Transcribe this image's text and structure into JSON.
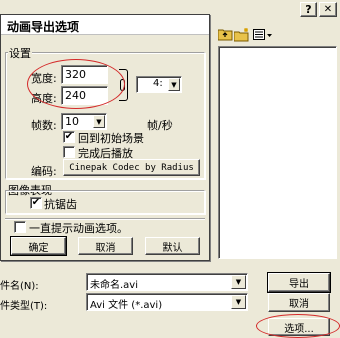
{
  "parent_window": {
    "top_buttons": {
      "help": "?",
      "close": "✕"
    },
    "toolbar_icons": [
      "up-folder-icon",
      "new-folder-icon",
      "view-menu-icon"
    ],
    "filename_label": "件名(N):",
    "filename_value": "未命名.avi",
    "filetype_label": "件类型(T):",
    "filetype_value": "Avi 文件 (*.avi)",
    "export_button": "导出",
    "cancel_button": "取消",
    "options_button": "选项..."
  },
  "dialog": {
    "title": "动画导出选项",
    "size_group_label": "设置",
    "width_label": "宽度:",
    "width_value": "320",
    "height_label": "高度:",
    "height_value": "240",
    "aspect_value": "4:",
    "fps_label": "帧数:",
    "fps_value": "10",
    "fps_unit": "帧/秒",
    "rewind_label": "回到初始场景",
    "rewind_checked": true,
    "play_after_label": "完成后播放",
    "play_after_checked": false,
    "codec_label": "编码:",
    "codec_button": "Cinepak Codec by Radius",
    "image_group_label": "图像表现",
    "antialias_label": "抗锯齿",
    "antialias_checked": true,
    "always_prompt_label": "一直提示动画选项。",
    "always_prompt_checked": false,
    "ok_button": "确定",
    "cancel_button": "取消",
    "default_button": "默认"
  },
  "colors": {
    "dialog_bg": "#ece9d8",
    "title_bar": "#ffffff",
    "annotation_red": "#d42a2a"
  }
}
